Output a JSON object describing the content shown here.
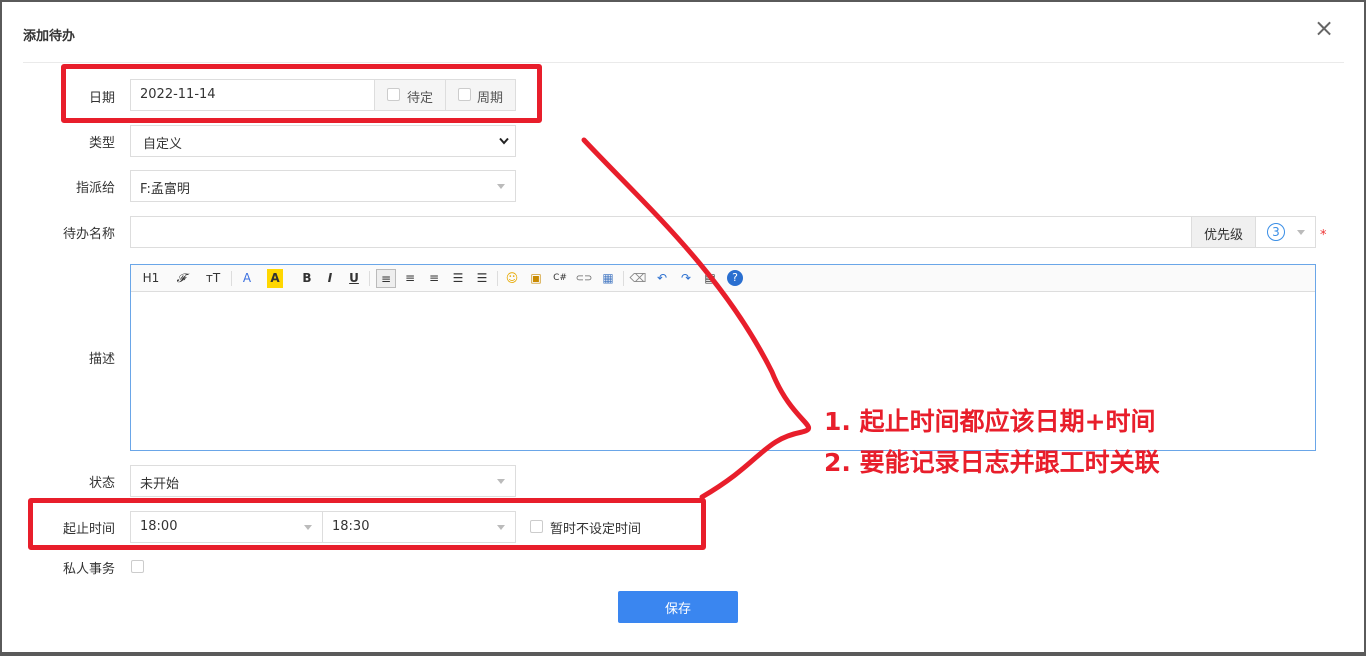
{
  "dialog": {
    "title": "添加待办",
    "close_label": "×"
  },
  "date": {
    "label": "日期",
    "value": "2022-11-14",
    "pending_label": "待定",
    "cycle_label": "周期"
  },
  "type": {
    "label": "类型",
    "value": "自定义"
  },
  "assign": {
    "label": "指派给",
    "value": "F:孟富明"
  },
  "name": {
    "label": "待办名称",
    "value": "",
    "priority_label": "优先级",
    "priority_value": "3",
    "required_mark": "*"
  },
  "editor": {
    "label": "描述",
    "toolbar": [
      "H1",
      "𝓕",
      "тT",
      "A",
      "A",
      "B",
      "I",
      "U",
      "≡",
      "≡",
      "≡",
      "☰",
      "☰",
      "☺",
      "▣",
      "C#",
      "⊂⊃",
      "▦",
      "⌫",
      "↶",
      "↷",
      "▤",
      "?"
    ]
  },
  "status": {
    "label": "状态",
    "value": "未开始"
  },
  "time": {
    "label": "起止时间",
    "start": "18:00",
    "end": "18:30",
    "unset_label": "暂时不设定时间"
  },
  "private": {
    "label": "私人事务"
  },
  "save_label": "保存",
  "annotation": {
    "line1": "1. 起止时间都应该日期+时间",
    "line2": "2. 要能记录日志并跟工时关联",
    "color": "#e81e2b"
  }
}
